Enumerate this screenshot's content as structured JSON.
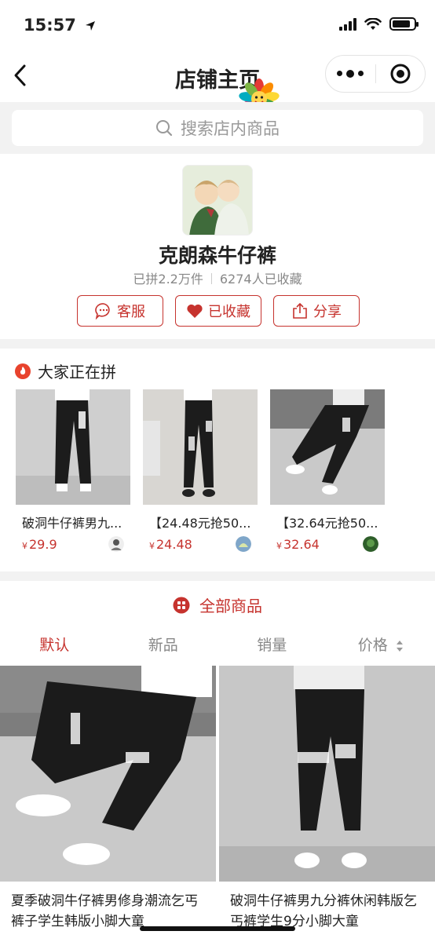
{
  "status_bar": {
    "time": "15:57",
    "battery_level": 0.85
  },
  "nav": {
    "title": "店铺主页"
  },
  "search": {
    "placeholder": "搜索店内商品"
  },
  "shop": {
    "name": "克朗森牛仔裤",
    "sold": "已拼2.2万件",
    "favorites": "6274人已收藏",
    "actions": {
      "service": "客服",
      "favorited": "已收藏",
      "share": "分享"
    }
  },
  "group_section": {
    "title": "大家正在拼",
    "items": [
      {
        "name": "破洞牛仔裤男九...",
        "currency": "¥",
        "price": "29.9"
      },
      {
        "name": "【24.48元抢50...",
        "currency": "¥",
        "price": "24.48"
      },
      {
        "name": "【32.64元抢50...",
        "currency": "¥",
        "price": "32.64"
      }
    ]
  },
  "goods_section": {
    "title": "全部商品",
    "sort_tabs": {
      "default": "默认",
      "new": "新品",
      "sales": "销量",
      "price": "价格"
    },
    "items": [
      {
        "name": "夏季破洞牛仔裤男修身潮流乞丐裤子学生韩版小脚大童"
      },
      {
        "name": "破洞牛仔裤男九分裤休闲韩版乞丐裤学生9分小脚大童"
      }
    ]
  },
  "colors": {
    "accent": "#c6332e",
    "fire": "#e8432d"
  }
}
